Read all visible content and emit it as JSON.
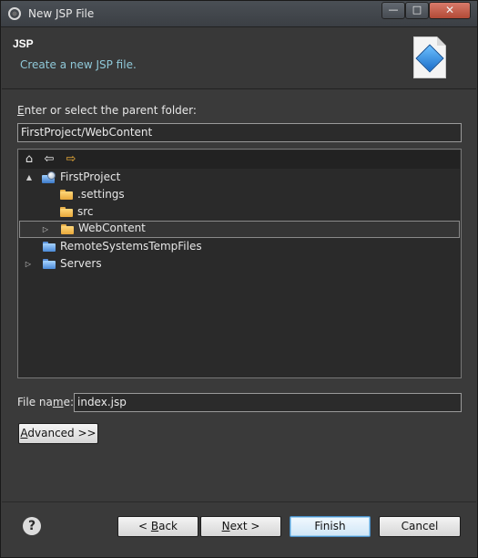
{
  "window": {
    "title": "New JSP File",
    "minimize": "—",
    "maximize": "□",
    "close": "✕"
  },
  "header": {
    "title": "JSP",
    "description": "Create a new JSP file."
  },
  "parent_folder": {
    "label_pre": "",
    "label_u": "E",
    "label_post": "nter or select the parent folder:",
    "value": "FirstProject/WebContent"
  },
  "tree": {
    "toolbar": {
      "home": "⌂",
      "back": "⇦",
      "forward": "⇨"
    },
    "items": [
      {
        "label": "FirstProject",
        "expander": "▲",
        "kind": "project"
      },
      {
        "label": ".settings",
        "expander": "",
        "kind": "folder"
      },
      {
        "label": "src",
        "expander": "",
        "kind": "folder"
      },
      {
        "label": "WebContent",
        "expander": "▷",
        "kind": "folder",
        "selected": true
      },
      {
        "label": "RemoteSystemsTempFiles",
        "expander": "",
        "kind": "folder-blue"
      },
      {
        "label": "Servers",
        "expander": "▷",
        "kind": "folder-blue"
      }
    ]
  },
  "file_name": {
    "label_pre": "File na",
    "label_u": "m",
    "label_post": "e:",
    "value": "index.jsp"
  },
  "advanced": {
    "label_u": "A",
    "label_post": "dvanced >>"
  },
  "buttons": {
    "help": "?",
    "back_pre": "< ",
    "back_u": "B",
    "back_post": "ack",
    "next_u": "N",
    "next_post": "ext >",
    "finish": "Finish",
    "cancel": "Cancel"
  }
}
